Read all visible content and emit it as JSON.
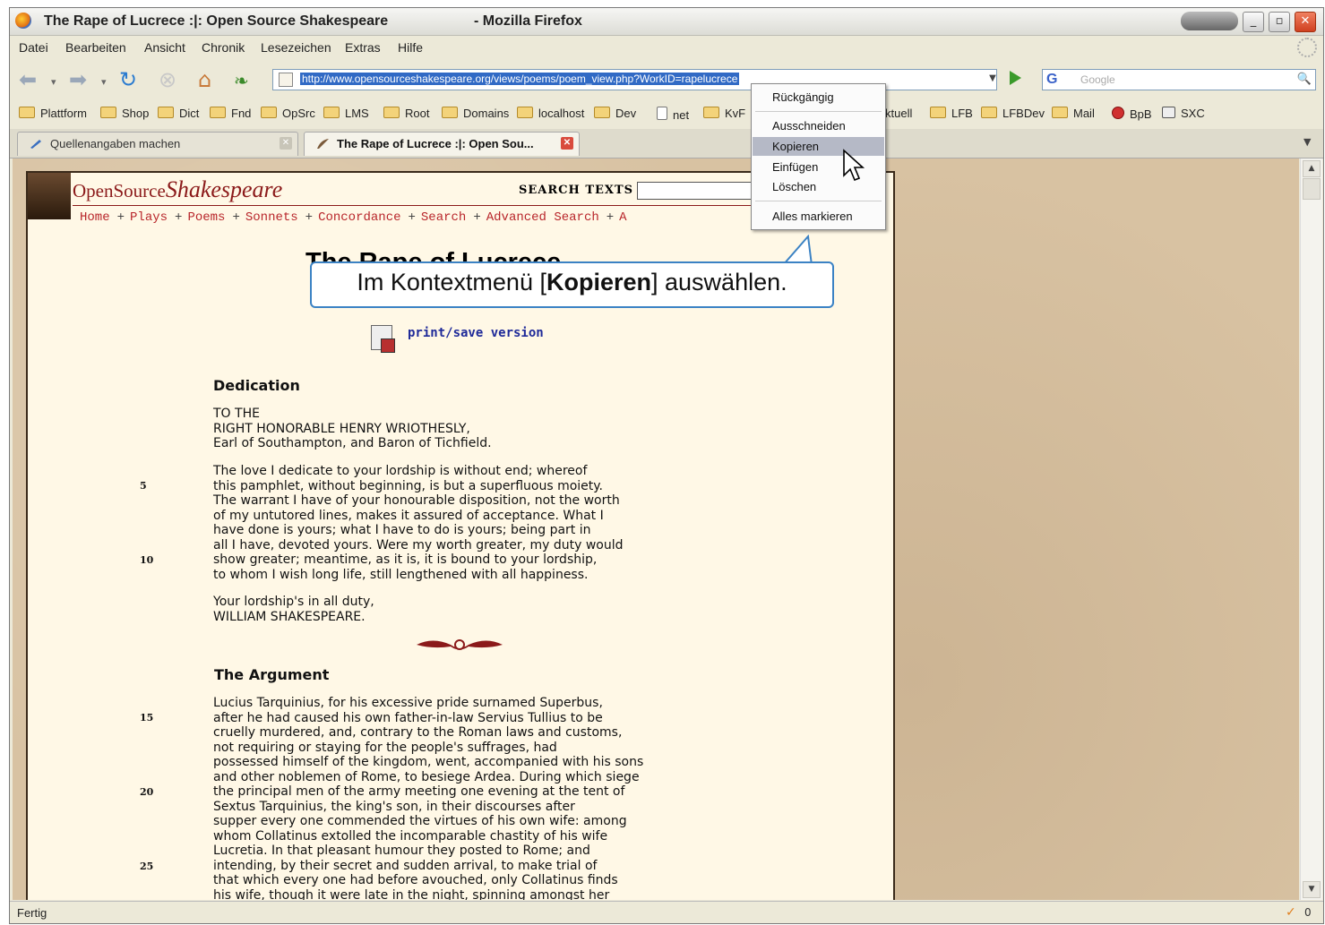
{
  "window": {
    "title_left": "The Rape of Lucrece :|: Open Source Shakespeare",
    "title_right": "- Mozilla Firefox",
    "btn_min": "_",
    "btn_max": "▫",
    "btn_close": "✕"
  },
  "menubar": [
    "Datei",
    "Bearbeiten",
    "Ansicht",
    "Chronik",
    "Lesezeichen",
    "Extras",
    "Hilfe"
  ],
  "navbar": {
    "url": "http://www.opensourceshakespeare.org/views/poems/poem_view.php?WorkID=rapelucrece",
    "search_placeholder": "Google",
    "search_engine": "G"
  },
  "bookmarks": [
    "Plattform",
    "Shop",
    "Dict",
    "Fnd",
    "OpSrc",
    "LMS",
    "Root",
    "Domains",
    "localhost",
    "Dev",
    "net",
    "KvF",
    "ktuell",
    "LFB",
    "LFBDev",
    "Mail",
    "BpB",
    "SXC"
  ],
  "tabs": [
    {
      "label": "Quellenangaben machen"
    },
    {
      "label": "The Rape of Lucrece :|: Open Sou..."
    }
  ],
  "site": {
    "logo_small": "OpenSource",
    "logo_big": "Shakespeare",
    "search_label": "SEARCH TEXTS",
    "nav": [
      "Home",
      "Plays",
      "Poems",
      "Sonnets",
      "Concordance",
      "Search",
      "Advanced Search",
      "A"
    ]
  },
  "poem": {
    "title": "The Rape of Lucrece",
    "print_link": "print/save version",
    "dedication_heading": "Dedication",
    "dedication_address": "TO THE\nRIGHT HONORABLE HENRY WRIOTHESLY,\nEarl of Southampton, and Baron of Tichfield.",
    "dedication_body": "The love I dedicate to your lordship is without end; whereof\nthis pamphlet, without beginning, is but a superfluous moiety.\nThe warrant I have of your honourable disposition, not the worth\nof my untutored lines, makes it assured of acceptance. What I\nhave done is yours; what I have to do is yours; being part in\nall I have, devoted yours. Were my worth greater, my duty would\nshow greater; meantime, as it is, it is bound to your lordship,\nto whom I wish long life, still lengthened with all happiness.",
    "dedication_sign": "Your lordship's in all duty,\nWILLIAM SHAKESPEARE.",
    "argument_heading": "The Argument",
    "argument_body": "Lucius Tarquinius, for his excessive pride surnamed Superbus,\nafter he had caused his own father-in-law Servius Tullius to be\ncruelly murdered, and, contrary to the Roman laws and customs,\nnot requiring or staying for the people's suffrages, had\npossessed himself of the kingdom, went, accompanied with his sons\nand other noblemen of Rome, to besiege Ardea. During which siege\nthe principal men of the army meeting one evening at the tent of\nSextus Tarquinius, the king's son, in their discourses after\nsupper every one commended the virtues of his own wife: among\nwhom Collatinus extolled the incomparable chastity of his wife\nLucretia. In that pleasant humour they posted to Rome; and\nintending, by their secret and sudden arrival, to make trial of\nthat which every one had before avouched, only Collatinus finds\nhis wife, though it were late in the night, spinning amongst her",
    "line_numbers": [
      "5",
      "10",
      "15",
      "20",
      "25"
    ]
  },
  "context_menu": {
    "items": [
      "Rückgängig",
      "Ausschneiden",
      "Kopieren",
      "Einfügen",
      "Löschen",
      "Alles markieren"
    ],
    "active": "Kopieren"
  },
  "callout": {
    "prefix": "Im Kontextmenü [",
    "bold": "Kopieren",
    "suffix": "] auswählen."
  },
  "status": {
    "text": "Fertig",
    "count": "0"
  },
  "colors": {
    "accent_selection": "#316ac5",
    "site_red": "#b8252a",
    "callout_border": "#3b82c4"
  }
}
